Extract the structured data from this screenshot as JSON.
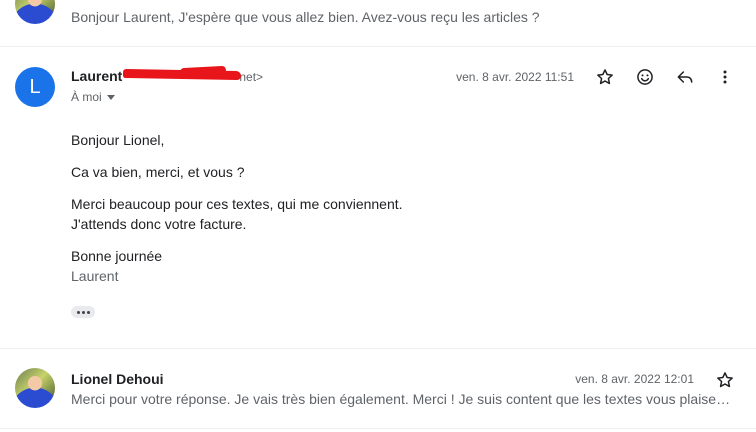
{
  "messages": {
    "top": {
      "snippet": "Bonjour Laurent, J'espère que vous allez bien. Avez-vous reçu les articles ?"
    },
    "open": {
      "avatar_letter": "L",
      "sender_name": "Laurent",
      "sender_email_visible": "net>",
      "to_label": "À moi",
      "date": "ven. 8 avr. 2022 11:51",
      "body": {
        "greeting": "Bonjour Lionel,",
        "line1": "Ca va bien, merci, et vous ?",
        "line2a": "Merci beaucoup pour ces textes, qui me conviennent.",
        "line2b": "J'attends donc votre facture.",
        "closing": "Bonne journée",
        "signature": "Laurent"
      }
    },
    "bottom": {
      "sender_name": "Lionel Dehoui",
      "date": "ven. 8 avr. 2022 12:01",
      "snippet": "Merci pour votre réponse. Je vais très bien également. Merci ! Je suis content que les textes vous plaisent. D'acc..."
    }
  },
  "icons": {
    "star": "star-icon",
    "emoji": "emoji-icon",
    "reply": "reply-icon",
    "more": "more-vert-icon",
    "ellipsis": "show-trimmed-content-icon"
  },
  "colors": {
    "avatar_blue": "#1a73e8",
    "redaction": "#e8151b",
    "secondary_text": "#5f6368"
  }
}
